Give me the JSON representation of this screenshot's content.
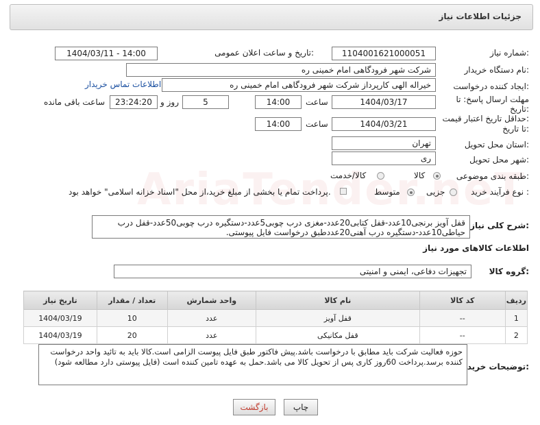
{
  "header": {
    "title": "جزئیات اطلاعات نیاز"
  },
  "fields": {
    "need_number_label": "شماره نیاز:",
    "need_number": "1104001621000051",
    "announce_label": "تاریخ و ساعت اعلان عمومی:",
    "announce_value": "1404/03/11 - 14:00",
    "buyer_org_label": "نام دستگاه خریدار:",
    "buyer_org": "شرکت شهر فرودگاهی امام خمینی  ره",
    "creator_label": "ایجاد کننده درخواست:",
    "creator": "خیراله الهی کارپرداز شرکت شهر فرودگاهی امام خمینی  ره",
    "buyer_contact_link": "اطلاعات تماس خریدار",
    "deadline_label_line1": "مهلت ارسال پاسخ: تا",
    "deadline_label_line2": "تاریخ:",
    "deadline_date": "1404/03/17",
    "time_label": "ساعت",
    "deadline_time": "14:00",
    "days_value": "5",
    "days_label": "روز و",
    "remaining_time": "23:24:20",
    "remaining_label": "ساعت باقی مانده",
    "validity_label_line1": "حداقل تاریخ اعتبار قیمت:",
    "validity_label_line2": "تا تاریخ:",
    "validity_date": "1404/03/21",
    "validity_time": "14:00",
    "province_label": "استان محل تحویل:",
    "province": "تهران",
    "city_label": "شهر محل تحویل:",
    "city": "ری",
    "category_label": "طبقه بندی موضوعی:",
    "category_options": [
      "کالا",
      "کالا/خدمت"
    ],
    "process_label": "نوع فرآیند خرید :",
    "process_options": [
      "جزیی",
      "متوسط"
    ],
    "payment_note": "پرداخت تمام یا بخشی از مبلغ خرید،از محل \"اسناد خزانه اسلامی\" خواهد بود.",
    "description_label": "شرح کلی نیاز:",
    "description": "قفل آویز برنجی10عدد-قفل کتابی20عدد-مغزی درب چوبی5عدد-دستگیره درب چوبی50عدد-قفل درب حیاطی10عدد-دستگیره درب آهنی20عددطبق درخواست فایل پیوستی.",
    "goods_info_title": "اطلاعات کالاهای مورد نیاز",
    "goods_group_label": "گروه کالا:",
    "goods_group": "تجهیزات دفاعی، ایمنی و امنیتی",
    "buyer_notes_label": "توضیحات خریدار:",
    "buyer_notes": "حوزه فعالیت شرکت باید مطابق با درخواست باشد.پیش فاکتور طبق فایل پیوست الزامی است.کالا باید به تائید واحد درخواست کننده برسد.پرداخت 60روز کاری پس از تحویل کالا می باشد.حمل به عهده تامین کننده است (فایل پیوستی دارد مطالعه شود)"
  },
  "table": {
    "headers": [
      "ردیف",
      "کد کالا",
      "نام کالا",
      "واحد شمارش",
      "تعداد / مقدار",
      "تاریخ نیاز"
    ],
    "rows": [
      [
        "1",
        "--",
        "قفل آویز",
        "عدد",
        "10",
        "1404/03/19"
      ],
      [
        "2",
        "--",
        "قفل مکانیکی",
        "عدد",
        "20",
        "1404/03/19"
      ]
    ]
  },
  "buttons": {
    "print": "چاپ",
    "back": "بازگشت"
  },
  "watermark": "AriaTender.neT",
  "colors": {
    "link": "#1a4fa0",
    "header_bg": "#e6e6e6",
    "back_button_text": "#c0392b"
  }
}
